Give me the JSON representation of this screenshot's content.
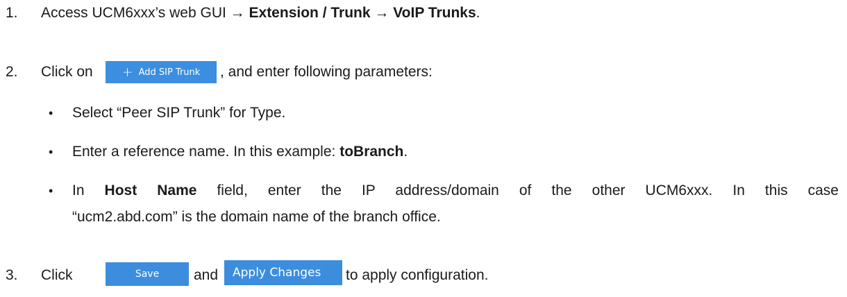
{
  "step1": {
    "number": "1.",
    "text_pre": "Access UCM6xxx’s web GUI ",
    "arrow1": "→",
    "menu1": " Extension / Trunk ",
    "arrow2": "→",
    "menu2": " VoIP Trunks",
    "text_post": "."
  },
  "step2": {
    "number": "2.",
    "text_pre": "Click on",
    "button_label": "Add SIP Trunk",
    "button_icon": "+",
    "text_post": ", and enter following parameters:",
    "bullets": {
      "b1": {
        "text": "Select “Peer SIP Trunk” for Type."
      },
      "b2": {
        "text_pre": "Enter a reference name. In this example: ",
        "bold": "toBranch",
        "text_post": "."
      },
      "b3": {
        "text_pre": "In ",
        "bold": "Host Name",
        "text_post": " field, enter the IP address/domain of the other UCM6xxx. In this case",
        "line2": "“ucm2.abd.com” is the domain name of the branch office."
      }
    }
  },
  "step3": {
    "number": "3.",
    "text_pre": "Click",
    "save_label": "Save",
    "text_mid": "and",
    "apply_label": "Apply Changes",
    "text_post": "to apply configuration."
  },
  "colors": {
    "button_blue": "#3c8dde",
    "text": "#1a1a1a"
  }
}
